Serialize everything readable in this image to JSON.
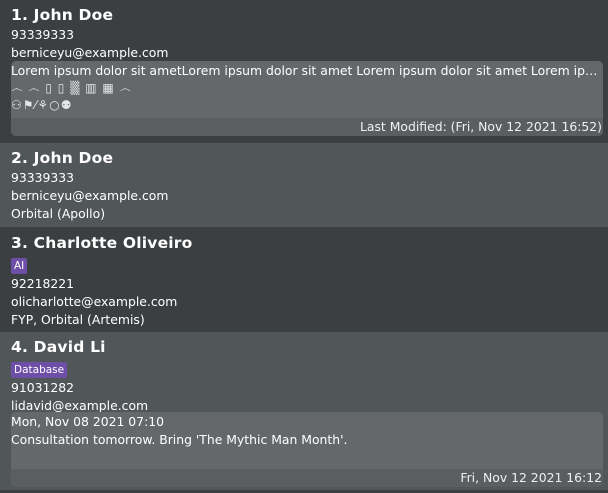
{
  "persons": [
    {
      "index_name": "1.  John Doe",
      "phone": "93339333",
      "email": "berniceyu@example.com",
      "note": {
        "text": "Lorem ipsum dolor sit ametLorem ipsum dolor sit amet Lorem ipsum dolor sit amet Lorem ipsum dolor sit amet",
        "emoji_line1": "෴ ෴  ▯  ▯  ▒  ▥  ▦  ෴",
        "emoji_line2": "⚇⚑⁄⚘○⚉",
        "footer": "Last Modified: (Fri, Nov 12 2021 16:52)"
      }
    },
    {
      "index_name": "2.  John Doe",
      "phone": "93339333",
      "email": "berniceyu@example.com",
      "groups": "Orbital (Apollo)"
    },
    {
      "index_name": "3.  Charlotte Oliveiro",
      "tag": "AI",
      "phone": "92218221",
      "email": "olicharlotte@example.com",
      "groups": "FYP, Orbital (Artemis)"
    },
    {
      "index_name": "4.  David Li",
      "tag": "Database",
      "phone": "91031282",
      "email": "lidavid@example.com",
      "note": {
        "date": "Mon, Nov 08 2021 07:10",
        "text": "Consultation tomorrow. Bring 'The Mythic Man Month'.",
        "footer": "Fri, Nov 12 2021 16:12"
      }
    }
  ]
}
